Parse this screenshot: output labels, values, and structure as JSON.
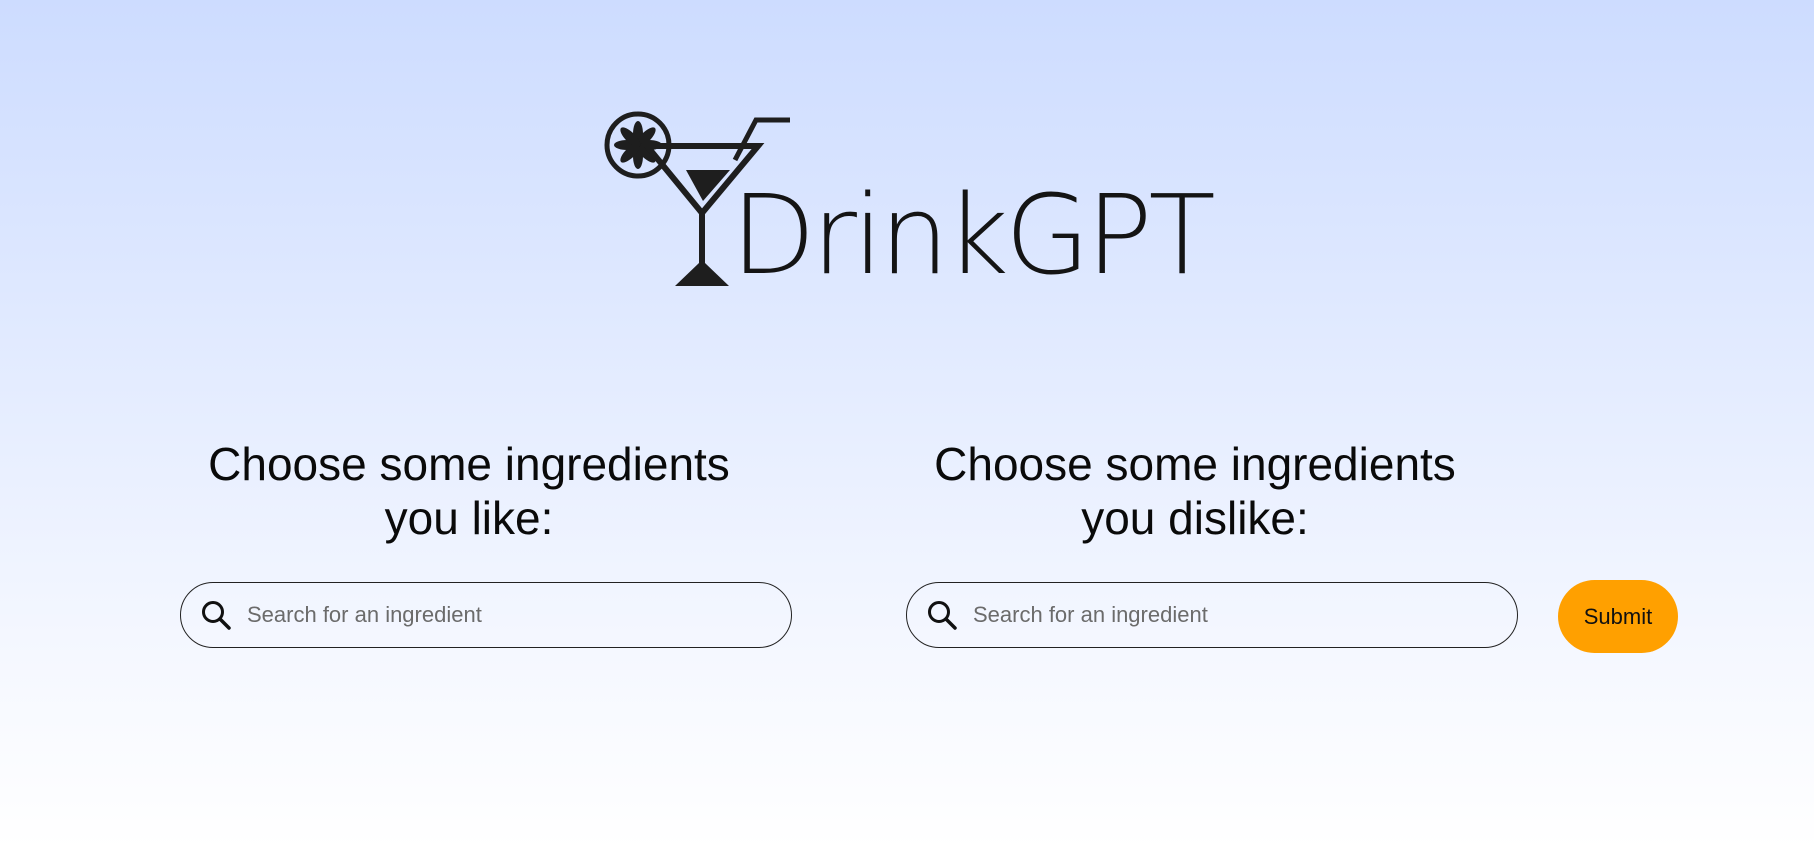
{
  "logo": {
    "text": "DrinkGPT",
    "icon": "cocktail-glass-icon"
  },
  "likes": {
    "heading_line1": "Choose some ingredients",
    "heading_line2": "you like:",
    "search_placeholder": "Search for an ingredient",
    "search_value": "",
    "icon": "search-icon"
  },
  "dislikes": {
    "heading_line1": "Choose some ingredients",
    "heading_line2": "you dislike:",
    "search_placeholder": "Search for an ingredient",
    "search_value": "",
    "icon": "search-icon"
  },
  "submit": {
    "label": "Submit"
  },
  "colors": {
    "background_top": "#cddcff",
    "background_bottom": "#ffffff",
    "submit_button": "#ffa000",
    "text": "#0a0a0a"
  }
}
